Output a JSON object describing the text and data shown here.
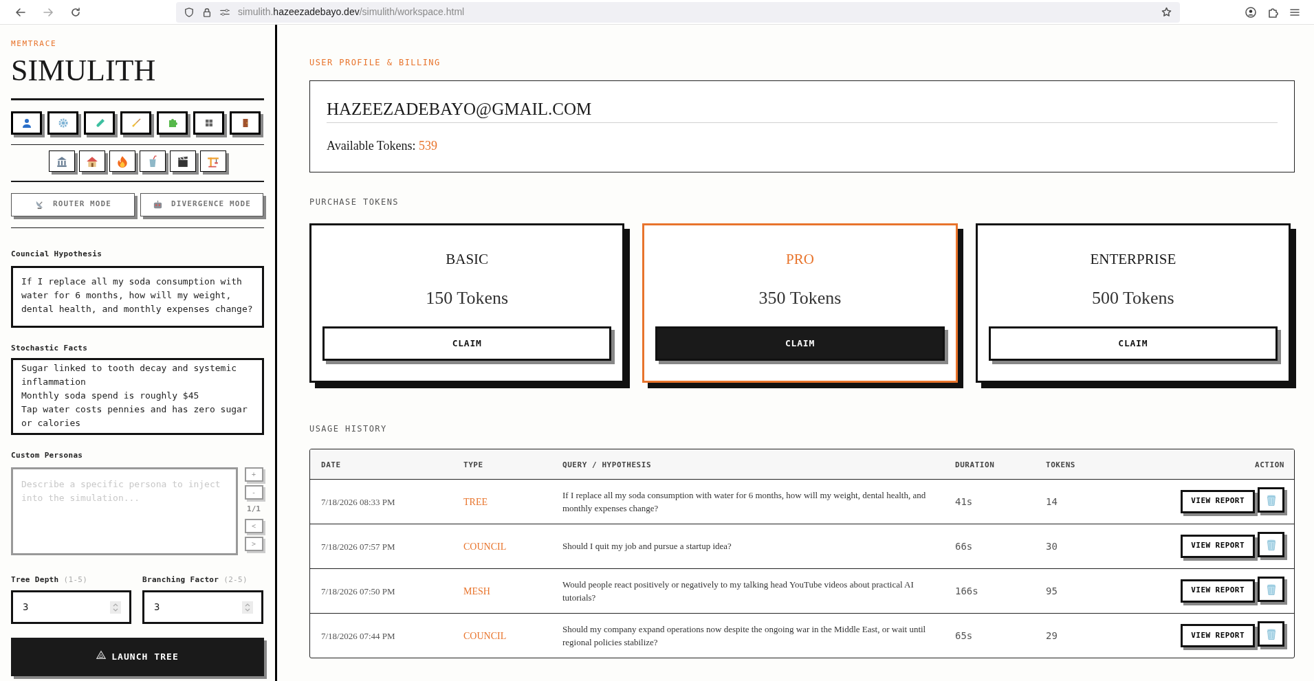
{
  "browser": {
    "url_parts": [
      "simulith.",
      "hazeezadebayo.dev",
      "/simulith/workspace.html"
    ]
  },
  "sidebar": {
    "brand": "MEMTRACE",
    "title": "SIMULITH",
    "mode_buttons": [
      {
        "label": "ROUTER MODE",
        "kind": "router"
      },
      {
        "label": "DIVERGENCE MODE",
        "kind": "divergence"
      }
    ],
    "hypothesis": {
      "label": "Councial Hypothesis",
      "value": "If I replace all my soda consumption with water for 6 months, how will my weight, dental health, and monthly expenses change?"
    },
    "facts": {
      "label": "Stochastic Facts",
      "value": "Sugar linked to tooth decay and systemic inflammation\nMonthly soda spend is roughly $45\nTap water costs pennies and has zero sugar or calories"
    },
    "personas": {
      "label": "Custom Personas",
      "placeholder": "Describe a specific persona to inject into the simulation...",
      "add": "+",
      "remove": "-",
      "counter": "1/1",
      "prev": "<",
      "next": ">"
    },
    "numbers": [
      {
        "label": "Tree Depth",
        "hint": "(1-5)",
        "value": "3"
      },
      {
        "label": "Branching Factor",
        "hint": "(2-5)",
        "value": "3"
      }
    ],
    "launch_button": "LAUNCH TREE"
  },
  "main": {
    "section_title": "USER PROFILE & BILLING",
    "profile": {
      "email": "HAZEEZADEBAYO@GMAIL.COM",
      "tokens_label": "Available Tokens:",
      "tokens": "539"
    },
    "purchase_title": "PURCHASE TOKENS",
    "plans": [
      {
        "name": "BASIC",
        "tokens": "150 Tokens",
        "button": "CLAIM",
        "selected": false
      },
      {
        "name": "PRO",
        "tokens": "350 Tokens",
        "button": "CLAIM",
        "selected": true
      },
      {
        "name": "ENTERPRISE",
        "tokens": "500 Tokens",
        "button": "CLAIM",
        "selected": false
      }
    ],
    "usage_title": "USAGE HISTORY",
    "table": {
      "columns": [
        "DATE",
        "TYPE",
        "QUERY / HYPOTHESIS",
        "DURATION",
        "TOKENS",
        "ACTION"
      ],
      "rows": [
        {
          "date": "7/18/2026 08:33 PM",
          "type": "TREE",
          "query": "If I replace all my soda consumption with water for 6 months, how will my weight, dental health, and monthly expenses change?",
          "duration": "41s",
          "tokens": "14",
          "action": "VIEW REPORT"
        },
        {
          "date": "7/18/2026 07:57 PM",
          "type": "COUNCIL",
          "query": "Should I quit my job and pursue a startup idea?",
          "duration": "66s",
          "tokens": "30",
          "action": "VIEW REPORT"
        },
        {
          "date": "7/18/2026 07:50 PM",
          "type": "MESH",
          "query": "Would people react positively or negatively to my talking head YouTube videos about practical AI tutorials?",
          "duration": "166s",
          "tokens": "95",
          "action": "VIEW REPORT"
        },
        {
          "date": "7/18/2026 07:44 PM",
          "type": "COUNCIL",
          "query": "Should my company expand operations now despite the ongoing war in the Middle East, or wait until regional policies stabilize?",
          "duration": "65s",
          "tokens": "29",
          "action": "VIEW REPORT"
        }
      ]
    }
  }
}
